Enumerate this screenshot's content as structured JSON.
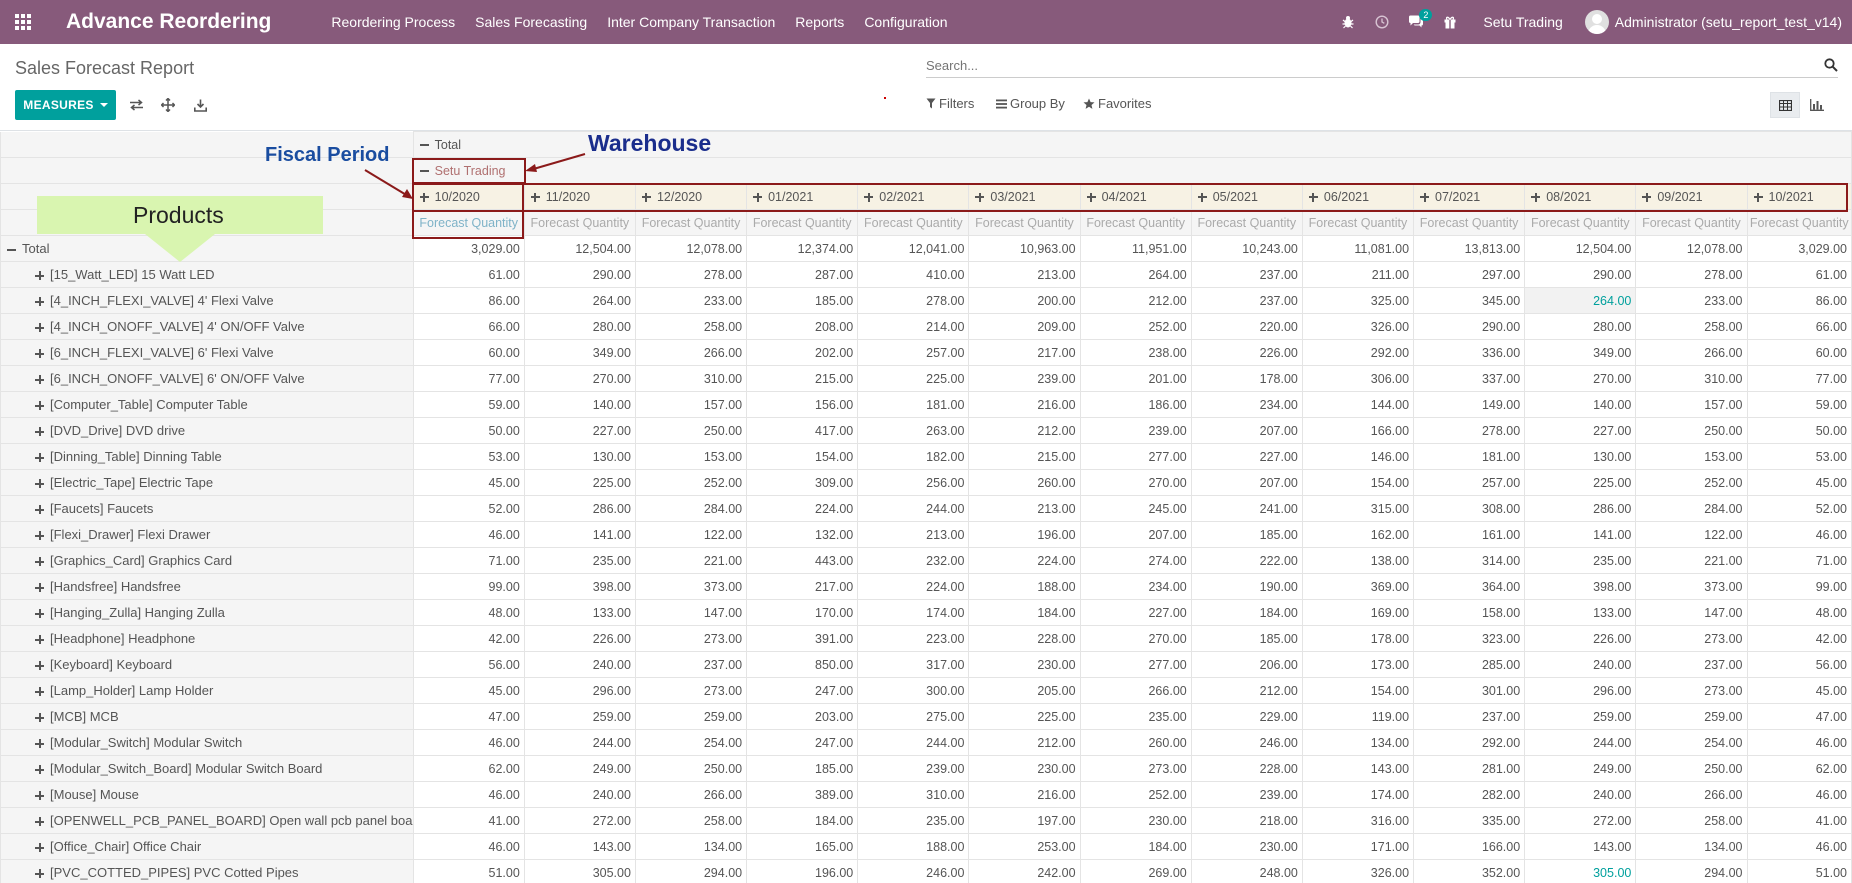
{
  "navbar": {
    "brand": "Advance Reordering",
    "menu": [
      "Reordering Process",
      "Sales Forecasting",
      "Inter Company Transaction",
      "Reports",
      "Configuration"
    ],
    "messages_badge": "2",
    "company": "Setu Trading",
    "user": "Administrator (setu_report_test_v14)"
  },
  "control": {
    "title": "Sales Forecast Report",
    "measures": "MEASURES",
    "search_placeholder": "Search...",
    "filters": "Filters",
    "group_by": "Group By",
    "favorites": "Favorites"
  },
  "pivot": {
    "header_total": "Total",
    "warehouse": "Setu Trading",
    "periods": [
      "10/2020",
      "11/2020",
      "12/2020",
      "01/2021",
      "02/2021",
      "03/2021",
      "04/2021",
      "05/2021",
      "06/2021",
      "07/2021",
      "08/2021",
      "09/2021",
      "10/2021"
    ],
    "measure": "Forecast Quantity",
    "row_total_label": "Total",
    "totals": [
      "3,029.00",
      "12,504.00",
      "12,078.00",
      "12,374.00",
      "12,041.00",
      "10,963.00",
      "11,951.00",
      "10,243.00",
      "11,081.00",
      "13,813.00",
      "12,504.00",
      "12,078.00",
      "3,029.00"
    ],
    "rows": [
      {
        "label": "[15_Watt_LED] 15 Watt LED",
        "values": [
          "61.00",
          "290.00",
          "278.00",
          "287.00",
          "410.00",
          "213.00",
          "264.00",
          "237.00",
          "211.00",
          "297.00",
          "290.00",
          "278.00",
          "61.00"
        ]
      },
      {
        "label": "[4_INCH_FLEXI_VALVE] 4' Flexi Valve",
        "values": [
          "86.00",
          "264.00",
          "233.00",
          "185.00",
          "278.00",
          "200.00",
          "212.00",
          "237.00",
          "325.00",
          "345.00",
          "264.00",
          "233.00",
          "86.00"
        ]
      },
      {
        "label": "[4_INCH_ONOFF_VALVE] 4' ON/OFF Valve",
        "values": [
          "66.00",
          "280.00",
          "258.00",
          "208.00",
          "214.00",
          "209.00",
          "252.00",
          "220.00",
          "326.00",
          "290.00",
          "280.00",
          "258.00",
          "66.00"
        ]
      },
      {
        "label": "[6_INCH_FLEXI_VALVE] 6' Flexi Valve",
        "values": [
          "60.00",
          "349.00",
          "266.00",
          "202.00",
          "257.00",
          "217.00",
          "238.00",
          "226.00",
          "292.00",
          "336.00",
          "349.00",
          "266.00",
          "60.00"
        ]
      },
      {
        "label": "[6_INCH_ONOFF_VALVE] 6' ON/OFF Valve",
        "values": [
          "77.00",
          "270.00",
          "310.00",
          "215.00",
          "225.00",
          "239.00",
          "201.00",
          "178.00",
          "306.00",
          "337.00",
          "270.00",
          "310.00",
          "77.00"
        ]
      },
      {
        "label": "[Computer_Table] Computer Table",
        "values": [
          "59.00",
          "140.00",
          "157.00",
          "156.00",
          "181.00",
          "216.00",
          "186.00",
          "234.00",
          "144.00",
          "149.00",
          "140.00",
          "157.00",
          "59.00"
        ]
      },
      {
        "label": "[DVD_Drive] DVD drive",
        "values": [
          "50.00",
          "227.00",
          "250.00",
          "417.00",
          "263.00",
          "212.00",
          "239.00",
          "207.00",
          "166.00",
          "278.00",
          "227.00",
          "250.00",
          "50.00"
        ]
      },
      {
        "label": "[Dinning_Table] Dinning Table",
        "values": [
          "53.00",
          "130.00",
          "153.00",
          "154.00",
          "182.00",
          "215.00",
          "277.00",
          "227.00",
          "146.00",
          "181.00",
          "130.00",
          "153.00",
          "53.00"
        ]
      },
      {
        "label": "[Electric_Tape] Electric Tape",
        "values": [
          "45.00",
          "225.00",
          "252.00",
          "309.00",
          "256.00",
          "260.00",
          "270.00",
          "207.00",
          "154.00",
          "257.00",
          "225.00",
          "252.00",
          "45.00"
        ]
      },
      {
        "label": "[Faucets] Faucets",
        "values": [
          "52.00",
          "286.00",
          "284.00",
          "224.00",
          "244.00",
          "213.00",
          "245.00",
          "241.00",
          "315.00",
          "308.00",
          "286.00",
          "284.00",
          "52.00"
        ]
      },
      {
        "label": "[Flexi_Drawer] Flexi Drawer",
        "values": [
          "46.00",
          "141.00",
          "122.00",
          "132.00",
          "213.00",
          "196.00",
          "207.00",
          "185.00",
          "162.00",
          "161.00",
          "141.00",
          "122.00",
          "46.00"
        ]
      },
      {
        "label": "[Graphics_Card] Graphics Card",
        "values": [
          "71.00",
          "235.00",
          "221.00",
          "443.00",
          "232.00",
          "224.00",
          "274.00",
          "222.00",
          "138.00",
          "314.00",
          "235.00",
          "221.00",
          "71.00"
        ]
      },
      {
        "label": "[Handsfree] Handsfree",
        "values": [
          "99.00",
          "398.00",
          "373.00",
          "217.00",
          "224.00",
          "188.00",
          "234.00",
          "190.00",
          "369.00",
          "364.00",
          "398.00",
          "373.00",
          "99.00"
        ]
      },
      {
        "label": "[Hanging_Zulla] Hanging Zulla",
        "values": [
          "48.00",
          "133.00",
          "147.00",
          "170.00",
          "174.00",
          "184.00",
          "227.00",
          "184.00",
          "169.00",
          "158.00",
          "133.00",
          "147.00",
          "48.00"
        ]
      },
      {
        "label": "[Headphone] Headphone",
        "values": [
          "42.00",
          "226.00",
          "273.00",
          "391.00",
          "223.00",
          "228.00",
          "270.00",
          "185.00",
          "178.00",
          "323.00",
          "226.00",
          "273.00",
          "42.00"
        ]
      },
      {
        "label": "[Keyboard] Keyboard",
        "values": [
          "56.00",
          "240.00",
          "237.00",
          "850.00",
          "317.00",
          "230.00",
          "277.00",
          "206.00",
          "173.00",
          "285.00",
          "240.00",
          "237.00",
          "56.00"
        ]
      },
      {
        "label": "[Lamp_Holder] Lamp Holder",
        "values": [
          "45.00",
          "296.00",
          "273.00",
          "247.00",
          "300.00",
          "205.00",
          "266.00",
          "212.00",
          "154.00",
          "301.00",
          "296.00",
          "273.00",
          "45.00"
        ]
      },
      {
        "label": "[MCB] MCB",
        "values": [
          "47.00",
          "259.00",
          "259.00",
          "203.00",
          "275.00",
          "225.00",
          "235.00",
          "229.00",
          "119.00",
          "237.00",
          "259.00",
          "259.00",
          "47.00"
        ]
      },
      {
        "label": "[Modular_Switch] Modular Switch",
        "values": [
          "46.00",
          "244.00",
          "254.00",
          "247.00",
          "244.00",
          "212.00",
          "260.00",
          "246.00",
          "134.00",
          "292.00",
          "244.00",
          "254.00",
          "46.00"
        ]
      },
      {
        "label": "[Modular_Switch_Board] Modular Switch Board",
        "values": [
          "62.00",
          "249.00",
          "250.00",
          "185.00",
          "239.00",
          "230.00",
          "273.00",
          "228.00",
          "143.00",
          "281.00",
          "249.00",
          "250.00",
          "62.00"
        ]
      },
      {
        "label": "[Mouse] Mouse",
        "values": [
          "46.00",
          "240.00",
          "266.00",
          "389.00",
          "310.00",
          "216.00",
          "252.00",
          "239.00",
          "174.00",
          "282.00",
          "240.00",
          "266.00",
          "46.00"
        ]
      },
      {
        "label": "[OPENWELL_PCB_PANEL_BOARD] Open wall pcb panel board",
        "values": [
          "41.00",
          "272.00",
          "258.00",
          "184.00",
          "235.00",
          "197.00",
          "230.00",
          "218.00",
          "316.00",
          "335.00",
          "272.00",
          "258.00",
          "41.00"
        ]
      },
      {
        "label": "[Office_Chair] Office Chair",
        "values": [
          "46.00",
          "143.00",
          "134.00",
          "165.00",
          "188.00",
          "253.00",
          "184.00",
          "230.00",
          "171.00",
          "166.00",
          "143.00",
          "134.00",
          "46.00"
        ]
      },
      {
        "label": "[PVC_COTTED_PIPES] PVC Cotted Pipes",
        "values": [
          "51.00",
          "305.00",
          "294.00",
          "196.00",
          "246.00",
          "242.00",
          "269.00",
          "248.00",
          "326.00",
          "352.00",
          "305.00",
          "294.00",
          "51.00"
        ]
      }
    ]
  },
  "annotations": {
    "warehouse": "Warehouse",
    "fiscal_period": "Fiscal Period",
    "products": "Products"
  },
  "colors": {
    "navbar": "#875a7b",
    "accent": "#00a09d",
    "annotation_box": "#8b1a1a"
  }
}
